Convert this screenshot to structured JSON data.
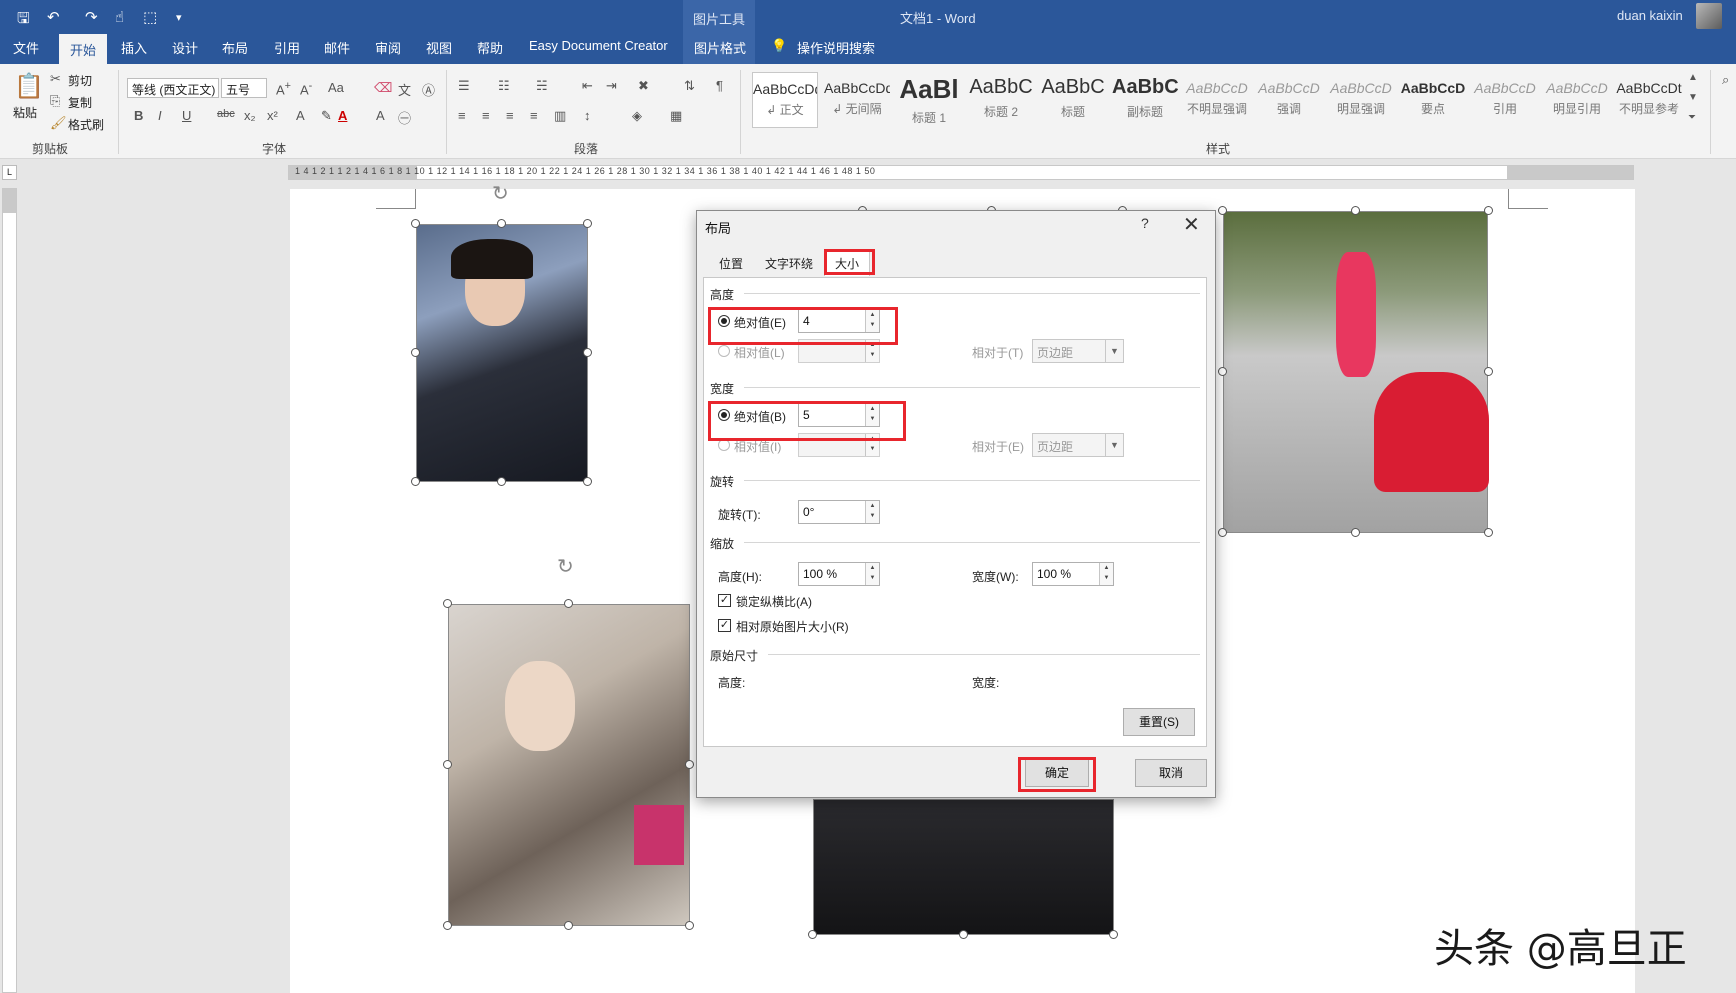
{
  "titlebar": {
    "quick_access": [
      "save-icon",
      "undo-icon",
      "redo-icon",
      "touch-mode-icon",
      "select-icon",
      "customize-icon"
    ],
    "context_tools": "图片工具",
    "doc_title": "文档1 - Word",
    "user": "duan kaixin"
  },
  "tabs": [
    "文件",
    "开始",
    "插入",
    "设计",
    "布局",
    "引用",
    "邮件",
    "审阅",
    "视图",
    "帮助",
    "Easy Document Creator",
    "图片格式"
  ],
  "tell_me": "操作说明搜索",
  "ribbon": {
    "clipboard": {
      "paste": "粘贴",
      "cut": "剪切",
      "copy": "复制",
      "format_painter": "格式刷",
      "label": "剪贴板"
    },
    "font": {
      "name": "等线 (西文正文)",
      "size": "五号",
      "label": "字体"
    },
    "paragraph": {
      "label": "段落"
    },
    "styles": {
      "label": "样式",
      "items": [
        {
          "sample": "AaBbCcDd",
          "name": "↲ 正文"
        },
        {
          "sample": "AaBbCcDd",
          "name": "↲ 无间隔"
        },
        {
          "sample": "AaBl",
          "name": "标题 1"
        },
        {
          "sample": "AaBbC",
          "name": "标题 2"
        },
        {
          "sample": "AaBbC",
          "name": "标题"
        },
        {
          "sample": "AaBbC",
          "name": "副标题"
        },
        {
          "sample": "AaBbCcD",
          "name": "不明显强调"
        },
        {
          "sample": "AaBbCcD",
          "name": "强调"
        },
        {
          "sample": "AaBbCcD",
          "name": "明显强调"
        },
        {
          "sample": "AaBbCcD",
          "name": "要点"
        },
        {
          "sample": "AaBbCcD",
          "name": "引用"
        },
        {
          "sample": "AaBbCcD",
          "name": "明显引用"
        },
        {
          "sample": "AaBbCcDt",
          "name": "不明显参考"
        }
      ]
    }
  },
  "ruler": {
    "tab_selector": "L",
    "numbers": "1 4 1 2 1   1 2 1 4 1 6 1 8 1 10 1 12 1 14 1 16 1 18 1 20 1 22 1 24 1 26 1 28 1 30 1 32 1 34 1 36 1 38 1 40 1 42 1 44 1 46 1 48 1 50"
  },
  "dialog": {
    "title": "布局",
    "help": "?",
    "close": "✕",
    "tabs": [
      "位置",
      "文字环绕",
      "大小"
    ],
    "height_section": "高度",
    "height_abs_label": "绝对值(E)",
    "height_abs_value": "4",
    "height_rel_label": "相对值(L)",
    "height_rel_to_label": "相对于(T)",
    "height_rel_to_value": "页边距",
    "width_section": "宽度",
    "width_abs_label": "绝对值(B)",
    "width_abs_value": "5",
    "width_rel_label": "相对值(I)",
    "width_rel_to_label": "相对于(E)",
    "width_rel_to_value": "页边距",
    "rotate_section": "旋转",
    "rotate_label": "旋转(T):",
    "rotate_value": "0°",
    "scale_section": "缩放",
    "scale_height_label": "高度(H):",
    "scale_height_value": "100 %",
    "scale_width_label": "宽度(W):",
    "scale_width_value": "100 %",
    "lock_aspect": "锁定纵横比(A)",
    "relative_original": "相对原始图片大小(R)",
    "original_section": "原始尺寸",
    "orig_height_label": "高度:",
    "orig_width_label": "宽度:",
    "reset": "重置(S)",
    "ok": "确定",
    "cancel": "取消"
  },
  "watermark": "头条 @高旦正",
  "colors": {
    "brand": "#2b579a",
    "highlight": "#e8262d"
  }
}
